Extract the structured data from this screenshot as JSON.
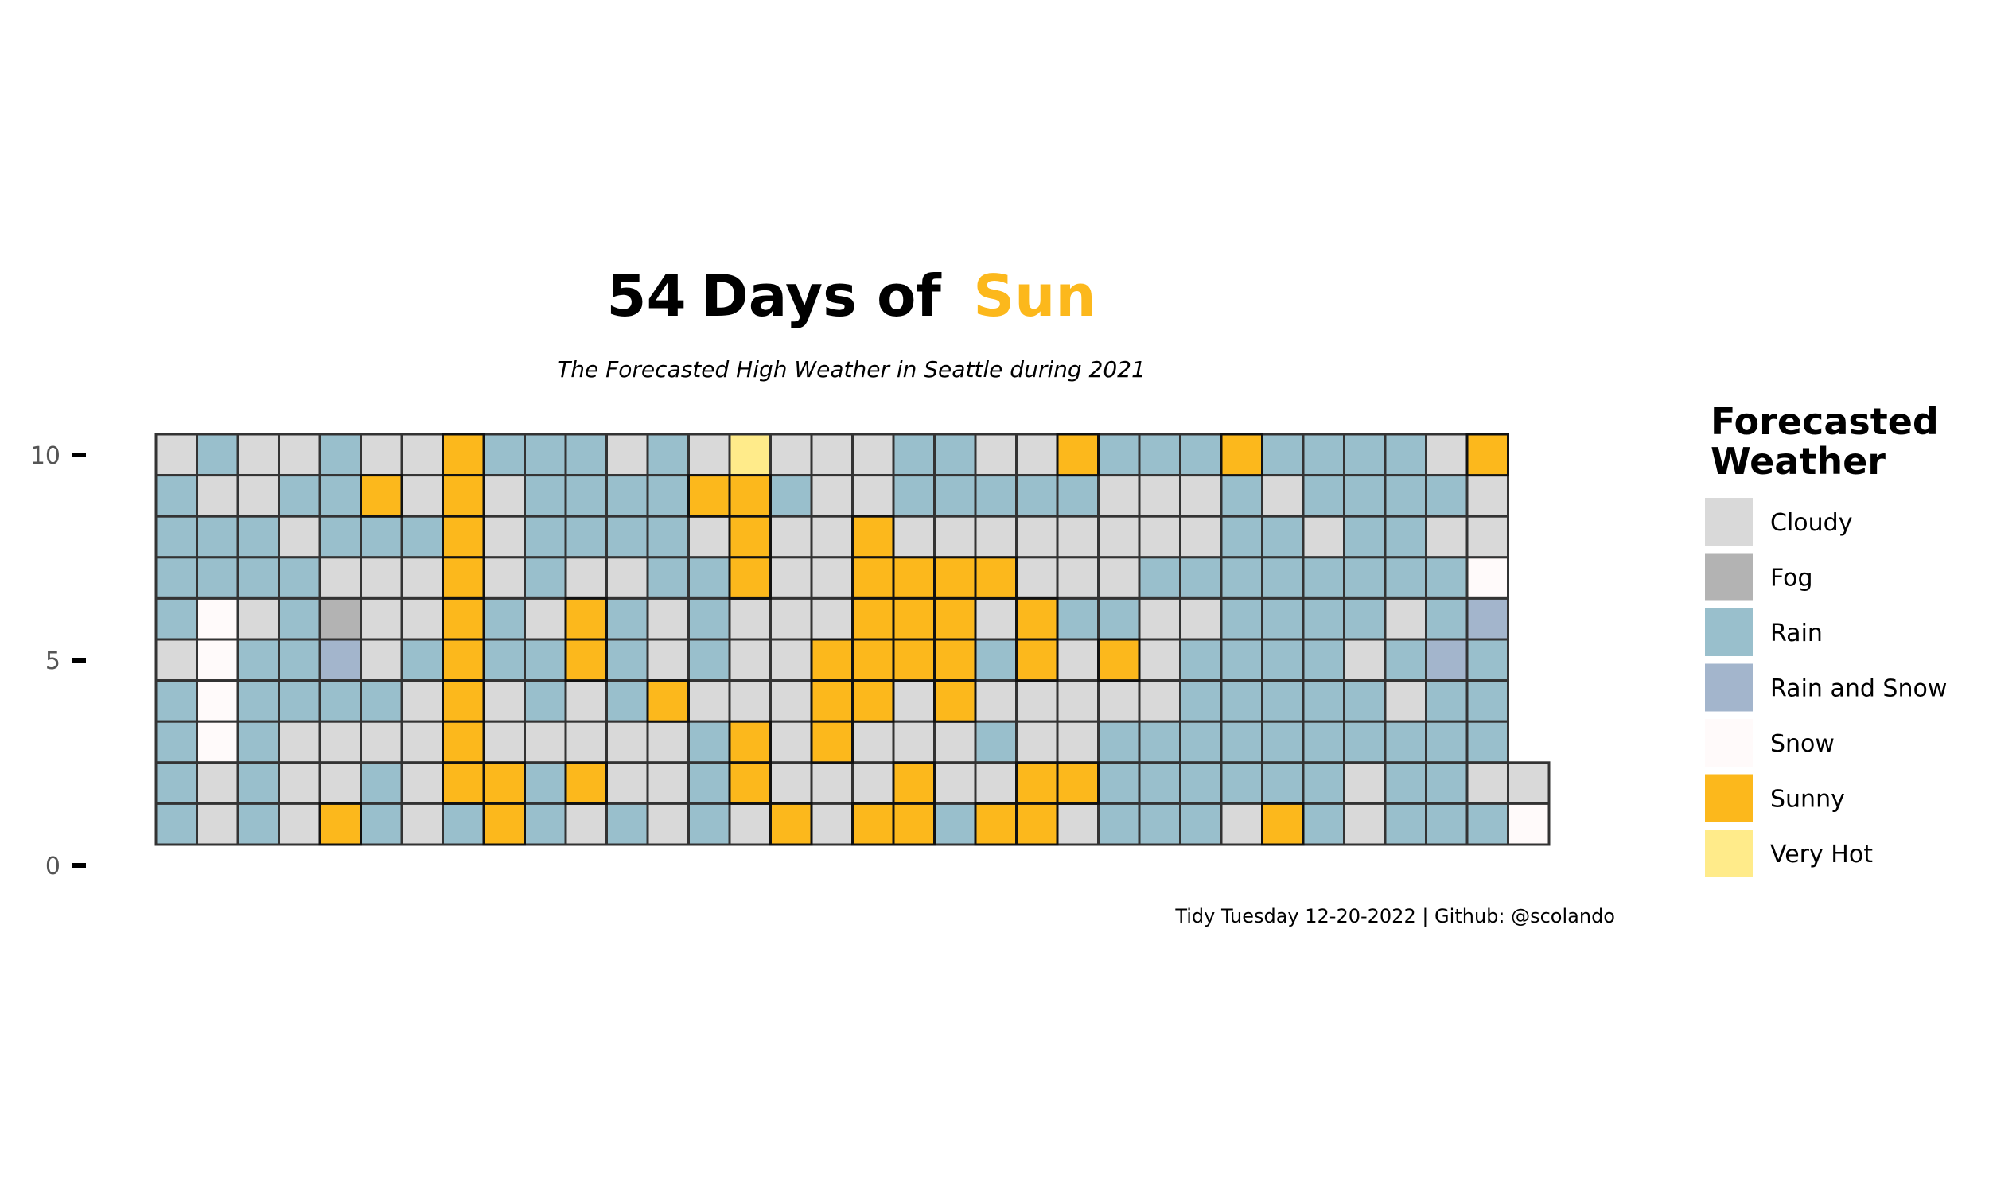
{
  "chart_data": {
    "type": "heatmap",
    "title": {
      "number": "54",
      "text": "Days of",
      "highlight": "Sun"
    },
    "subtitle": "The Forecasted High Weather in Seattle during 2021",
    "caption": "Tidy Tuesday 12-20-2022 | Github: @scolando",
    "y_ticks": [
      "0",
      "5",
      "10"
    ],
    "ylim": [
      0,
      10
    ],
    "legend_title": [
      "Forecasted",
      "Weather"
    ],
    "legend": [
      {
        "code": "C",
        "label": "Cloudy",
        "color": "#d9d9d9"
      },
      {
        "code": "F",
        "label": "Fog",
        "color": "#b3b3b3"
      },
      {
        "code": "R",
        "label": "Rain",
        "color": "#99bfcc"
      },
      {
        "code": "M",
        "label": "Rain and Snow",
        "color": "#a3b5cc"
      },
      {
        "code": "W",
        "label": "Snow",
        "color": "#fffafa"
      },
      {
        "code": "S",
        "label": "Sunny",
        "color": "#fcb81c"
      },
      {
        "code": "H",
        "label": "Very Hot",
        "color": "#ffeb8a"
      }
    ],
    "grid_note": "rows listed top (y=10) to bottom (y=1); each character is one day column",
    "rows": [
      "CRCCRCCSRRRCRCHCCCRRCCSRRRSRRRRCS",
      "RCCRRSCSCRRRRSSRCCRRRRRCCCRCRRRRC",
      "RRRCRRRSCRRRRCSCCSCCCCCCCCRRCRRCC",
      "RRRRCCCSCRCCRRSCCSSSSCCCRRRRRRRRW",
      "RWCRFCCSRCSRCRCCCSSSCSRRCCRRRRCRM",
      "CWRRMCRSRRSRCRCCSSSSRSCSCRRRRCRMR",
      "RWRRRRCSCRCRSCCCSSCSCCCCCRRRRRCRR",
      "RWRCCCCSCCCCCRSCSCCCRCCRRRRRRRRRR",
      "RCRCCRCSSRSCCRSCCCSCCSSRRRRRRCRRCC",
      "RCRCSRCRSRCRCRCSCSSRSSCRRRCSRCRRRW"
    ]
  }
}
